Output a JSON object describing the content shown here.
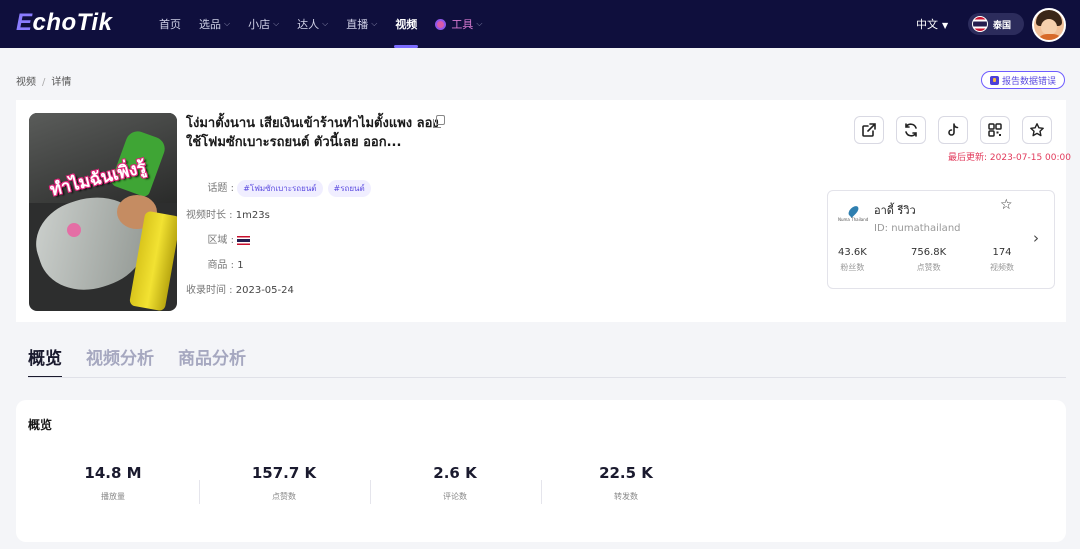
{
  "header": {
    "logo_e": "E",
    "logo_rest": "choTik",
    "nav": [
      "首页",
      "选品",
      "小店",
      "达人",
      "直播",
      "视频",
      "工具"
    ],
    "language": "中文",
    "region": "泰国"
  },
  "breadcrumb": {
    "parent": "视频",
    "current": "详情"
  },
  "report_button": "报告数据错误",
  "video": {
    "thumbnail_caption": "ทำไมฉันเพิ่งรู้",
    "title": "โง่มาตั้งนาน เสียเงินเข้าร้านทำไมตั้งแพง ลองใช้โฟมซักเบาะรถยนต์ ตัวนี้เลย ออก...",
    "topics_label": "话题 :",
    "topics": [
      "#โฟมซักเบาะรถยนต์",
      "#รถยนต์"
    ],
    "duration_label": "视频时长 :",
    "duration": "1m23s",
    "region_label": "区域 :",
    "product_label": "商品 :",
    "product_count": "1",
    "collected_label": "收录时间 :",
    "collected_date": "2023-05-24",
    "last_update": "最后更新: 2023-07-15 00:00"
  },
  "author": {
    "logo_text": "Numa Thailand",
    "name": "อาดี้ รีวิว",
    "id": "ID: numathailand",
    "stats": [
      {
        "value": "43.6K",
        "label": "粉丝数"
      },
      {
        "value": "756.8K",
        "label": "点赞数"
      },
      {
        "value": "174",
        "label": "视频数"
      }
    ]
  },
  "tabs": [
    "概览",
    "视频分析",
    "商品分析"
  ],
  "overview": {
    "title": "概览",
    "metrics": [
      {
        "value": "14.8 M",
        "label": "播放量"
      },
      {
        "value": "157.7 K",
        "label": "点赞数"
      },
      {
        "value": "2.6 K",
        "label": "评论数"
      },
      {
        "value": "22.5 K",
        "label": "转发数"
      }
    ]
  },
  "colors": {
    "nav_bg": "#0f0f3d",
    "accent": "#6e5cff",
    "update_red": "#e23b5c"
  }
}
